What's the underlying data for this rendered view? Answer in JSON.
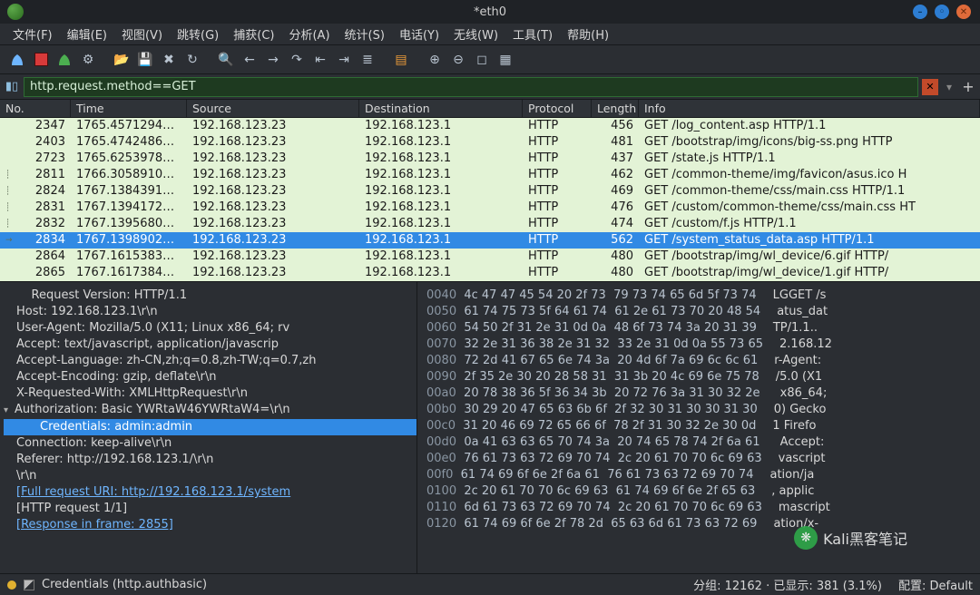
{
  "window": {
    "title": "*eth0"
  },
  "menu": [
    "文件(F)",
    "编辑(E)",
    "视图(V)",
    "跳转(G)",
    "捕获(C)",
    "分析(A)",
    "统计(S)",
    "电话(Y)",
    "无线(W)",
    "工具(T)",
    "帮助(H)"
  ],
  "filter": {
    "value": "http.request.method==GET"
  },
  "columns": {
    "no": "No.",
    "time": "Time",
    "src": "Source",
    "dst": "Destination",
    "proto": "Protocol",
    "len": "Length",
    "info": "Info"
  },
  "packets": [
    {
      "no": "2347",
      "time": "1765.4571294…",
      "src": "192.168.123.23",
      "dst": "192.168.123.1",
      "proto": "HTTP",
      "len": "456",
      "info": "GET /log_content.asp HTTP/1.1",
      "sel": false
    },
    {
      "no": "2403",
      "time": "1765.4742486…",
      "src": "192.168.123.23",
      "dst": "192.168.123.1",
      "proto": "HTTP",
      "len": "481",
      "info": "GET /bootstrap/img/icons/big-ss.png HTTP",
      "sel": false
    },
    {
      "no": "2723",
      "time": "1765.6253978…",
      "src": "192.168.123.23",
      "dst": "192.168.123.1",
      "proto": "HTTP",
      "len": "437",
      "info": "GET /state.js HTTP/1.1",
      "sel": false
    },
    {
      "no": "2811",
      "time": "1766.3058910…",
      "src": "192.168.123.23",
      "dst": "192.168.123.1",
      "proto": "HTTP",
      "len": "462",
      "info": "GET /common-theme/img/favicon/asus.ico H",
      "sel": false
    },
    {
      "no": "2824",
      "time": "1767.1384391…",
      "src": "192.168.123.23",
      "dst": "192.168.123.1",
      "proto": "HTTP",
      "len": "469",
      "info": "GET /common-theme/css/main.css HTTP/1.1",
      "sel": false
    },
    {
      "no": "2831",
      "time": "1767.1394172…",
      "src": "192.168.123.23",
      "dst": "192.168.123.1",
      "proto": "HTTP",
      "len": "476",
      "info": "GET /custom/common-theme/css/main.css HT",
      "sel": false
    },
    {
      "no": "2832",
      "time": "1767.1395680…",
      "src": "192.168.123.23",
      "dst": "192.168.123.1",
      "proto": "HTTP",
      "len": "474",
      "info": "GET /custom/f.js HTTP/1.1",
      "sel": false
    },
    {
      "no": "2834",
      "time": "1767.1398902…",
      "src": "192.168.123.23",
      "dst": "192.168.123.1",
      "proto": "HTTP",
      "len": "562",
      "info": "GET /system_status_data.asp HTTP/1.1",
      "sel": true
    },
    {
      "no": "2864",
      "time": "1767.1615383…",
      "src": "192.168.123.23",
      "dst": "192.168.123.1",
      "proto": "HTTP",
      "len": "480",
      "info": "GET /bootstrap/img/wl_device/6.gif HTTP/",
      "sel": false
    },
    {
      "no": "2865",
      "time": "1767.1617384…",
      "src": "192.168.123.23",
      "dst": "192.168.123.1",
      "proto": "HTTP",
      "len": "480",
      "info": "GET /bootstrap/img/wl_device/1.gif HTTP/",
      "sel": false
    }
  ],
  "details": {
    "lines": [
      {
        "txt": "    Request Version: HTTP/1.1"
      },
      {
        "txt": "Host: 192.168.123.1\\r\\n"
      },
      {
        "txt": "User-Agent: Mozilla/5.0 (X11; Linux x86_64; rv"
      },
      {
        "txt": "Accept: text/javascript, application/javascrip"
      },
      {
        "txt": "Accept-Language: zh-CN,zh;q=0.8,zh-TW;q=0.7,zh"
      },
      {
        "txt": "Accept-Encoding: gzip, deflate\\r\\n"
      },
      {
        "txt": "X-Requested-With: XMLHttpRequest\\r\\n"
      },
      {
        "txt": "Authorization: Basic YWRtaW46YWRtaW4=\\r\\n",
        "twist": "open"
      },
      {
        "txt": "Credentials: admin:admin",
        "sel": true,
        "indent": true
      },
      {
        "txt": "Connection: keep-alive\\r\\n"
      },
      {
        "txt": "Referer: http://192.168.123.1/\\r\\n"
      },
      {
        "txt": "\\r\\n"
      },
      {
        "txt": "[Full request URI: http://192.168.123.1/system",
        "link": true
      },
      {
        "txt": "[HTTP request 1/1]"
      },
      {
        "txt": "[Response in frame: 2855]",
        "link": true
      }
    ]
  },
  "hex": [
    {
      "off": "0040",
      "b": "4c 47 47 45 54 20 2f 73  79 73 74 65 6d 5f 73 74",
      "a": "LGGET /s"
    },
    {
      "off": "0050",
      "b": "61 74 75 73 5f 64 61 74  61 2e 61 73 70 20 48 54",
      "a": "atus_dat"
    },
    {
      "off": "0060",
      "b": "54 50 2f 31 2e 31 0d 0a  48 6f 73 74 3a 20 31 39",
      "a": "TP/1.1.."
    },
    {
      "off": "0070",
      "b": "32 2e 31 36 38 2e 31 32  33 2e 31 0d 0a 55 73 65",
      "a": "2.168.12"
    },
    {
      "off": "0080",
      "b": "72 2d 41 67 65 6e 74 3a  20 4d 6f 7a 69 6c 6c 61",
      "a": "r-Agent:"
    },
    {
      "off": "0090",
      "b": "2f 35 2e 30 20 28 58 31  31 3b 20 4c 69 6e 75 78",
      "a": "/5.0 (X1"
    },
    {
      "off": "00a0",
      "b": "20 78 38 36 5f 36 34 3b  20 72 76 3a 31 30 32 2e",
      "a": " x86_64;"
    },
    {
      "off": "00b0",
      "b": "30 29 20 47 65 63 6b 6f  2f 32 30 31 30 30 31 30",
      "a": "0) Gecko"
    },
    {
      "off": "00c0",
      "b": "31 20 46 69 72 65 66 6f  78 2f 31 30 32 2e 30 0d",
      "a": "1 Firefo"
    },
    {
      "off": "00d0",
      "b": "0a 41 63 63 65 70 74 3a  20 74 65 78 74 2f 6a 61",
      "a": " Accept:"
    },
    {
      "off": "00e0",
      "b": "76 61 73 63 72 69 70 74  2c 20 61 70 70 6c 69 63",
      "a": "vascript"
    },
    {
      "off": "00f0",
      "b": "61 74 69 6f 6e 2f 6a 61  76 61 73 63 72 69 70 74",
      "a": "ation/ja"
    },
    {
      "off": "0100",
      "b": "2c 20 61 70 70 6c 69 63  61 74 69 6f 6e 2f 65 63",
      "a": ", applic"
    },
    {
      "off": "0110",
      "b": "6d 61 73 63 72 69 70 74  2c 20 61 70 70 6c 69 63",
      "a": "mascript"
    },
    {
      "off": "0120",
      "b": "61 74 69 6f 6e 2f 78 2d  65 63 6d 61 73 63 72 69",
      "a": "ation/x-"
    }
  ],
  "status": {
    "field": "Credentials (http.authbasic)",
    "center": "分组: 12162 · 已显示: 381 (3.1%)",
    "right": "配置: Default"
  },
  "watermark": "Kali黑客笔记"
}
